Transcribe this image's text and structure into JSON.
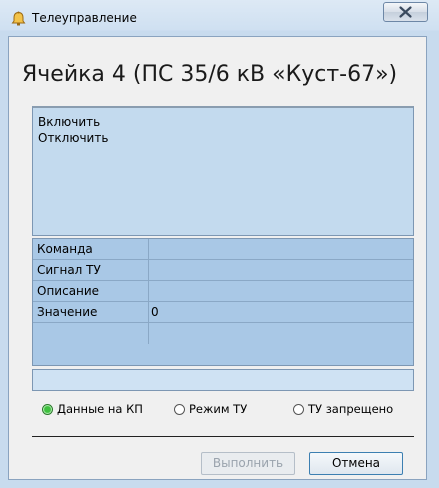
{
  "window": {
    "title": "Телеуправление",
    "close_label": "✕"
  },
  "header": {
    "cell_title": "Ячейка 4 (ПС 35/6 кВ «Куст-67»)"
  },
  "commands": [
    "Включить",
    "Отключить"
  ],
  "properties": [
    {
      "key": "Команда",
      "value": ""
    },
    {
      "key": "Сигнал ТУ",
      "value": ""
    },
    {
      "key": "Описание",
      "value": ""
    },
    {
      "key": "Значение",
      "value": "0"
    }
  ],
  "input_value": "",
  "radios": [
    {
      "label": "Данные на КП",
      "selected": true
    },
    {
      "label": "Режим ТУ",
      "selected": false
    },
    {
      "label": "ТУ запрещено",
      "selected": false
    }
  ],
  "buttons": {
    "execute": "Выполнить",
    "cancel": "Отмена"
  }
}
